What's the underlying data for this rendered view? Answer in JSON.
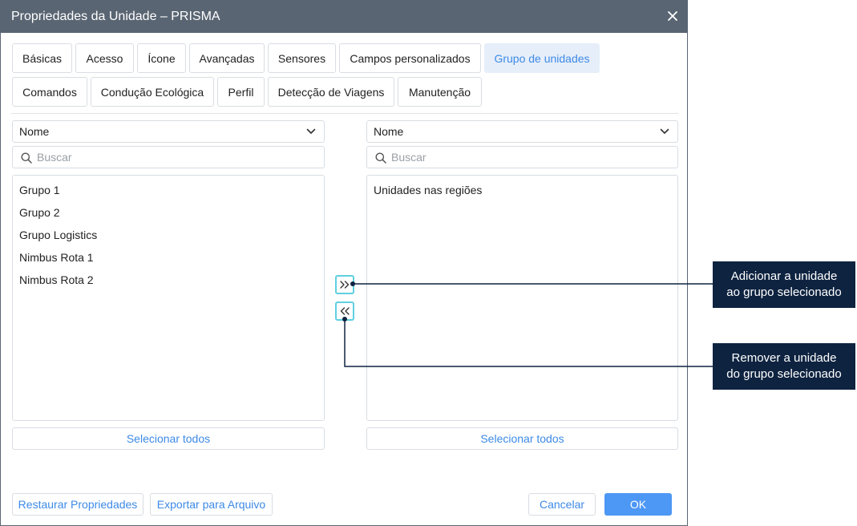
{
  "dialog": {
    "title": "Propriedades da Unidade – PRISMA",
    "close_label": "×"
  },
  "tabs": [
    {
      "label": "Básicas",
      "active": false
    },
    {
      "label": "Acesso",
      "active": false
    },
    {
      "label": "Ícone",
      "active": false
    },
    {
      "label": "Avançadas",
      "active": false
    },
    {
      "label": "Sensores",
      "active": false
    },
    {
      "label": "Campos personalizados",
      "active": false
    },
    {
      "label": "Grupo de unidades",
      "active": true
    },
    {
      "label": "Comandos",
      "active": false
    },
    {
      "label": "Condução Ecológica",
      "active": false
    },
    {
      "label": "Perfil",
      "active": false
    },
    {
      "label": "Detecção de Viagens",
      "active": false
    },
    {
      "label": "Manutenção",
      "active": false
    }
  ],
  "left_panel": {
    "sort_select": "Nome",
    "search_placeholder": "Buscar",
    "items": [
      "Grupo 1",
      "Grupo 2",
      "Grupo Logistics",
      "Nimbus Rota 1",
      "Nimbus Rota 2"
    ],
    "select_all": "Selecionar todos"
  },
  "right_panel": {
    "sort_select": "Nome",
    "search_placeholder": "Buscar",
    "content_text": "Unidades nas regiões",
    "select_all": "Selecionar todos"
  },
  "footer": {
    "restore": "Restaurar Propriedades",
    "export": "Exportar para Arquivo",
    "cancel": "Cancelar",
    "ok": "OK"
  },
  "callouts": {
    "add": [
      "Adicionar a unidade",
      "ao grupo selecionado"
    ],
    "remove": [
      "Remover a unidade",
      "do grupo selecionado"
    ]
  },
  "icons": {
    "close": "close-icon",
    "add": "double-chevron-right-icon",
    "remove": "double-chevron-left-icon",
    "search": "search-icon",
    "dropdown": "chevron-down-icon"
  },
  "colors": {
    "titlebar": "#5a6573",
    "accent": "#3d8ae6",
    "active_tab_bg": "#e6eef9",
    "arrow_border": "#5fd0e0",
    "callout_bg": "#0e2340",
    "primary_button": "#4d97f5"
  }
}
